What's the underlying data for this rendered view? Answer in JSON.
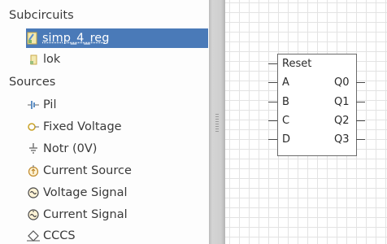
{
  "sidebar": {
    "subcircuits_header": "Subcircuits",
    "sources_header": "Sources",
    "subcircuits": [
      {
        "label": "simp_4_reg",
        "icon": "subcircuit-icon",
        "selected": true
      },
      {
        "label": "lok",
        "icon": "subcircuit-small-icon",
        "selected": false
      }
    ],
    "sources": [
      {
        "label": "Pil",
        "icon": "battery-icon"
      },
      {
        "label": "Fixed Voltage",
        "icon": "fixed-voltage-icon"
      },
      {
        "label": "Notr (0V)",
        "icon": "ground-icon"
      },
      {
        "label": "Current Source",
        "icon": "current-source-icon"
      },
      {
        "label": "Voltage Signal",
        "icon": "voltage-signal-icon"
      },
      {
        "label": "Current Signal",
        "icon": "current-signal-icon"
      },
      {
        "label": "CCCS",
        "icon": "cccs-icon"
      }
    ]
  },
  "canvas": {
    "component": {
      "inputs": [
        "Reset",
        "A",
        "B",
        "C",
        "D"
      ],
      "outputs": [
        "Q0",
        "Q1",
        "Q2",
        "Q3"
      ]
    }
  },
  "colors": {
    "selection": "#4a7ab8",
    "grid": "#e3e3e3"
  }
}
